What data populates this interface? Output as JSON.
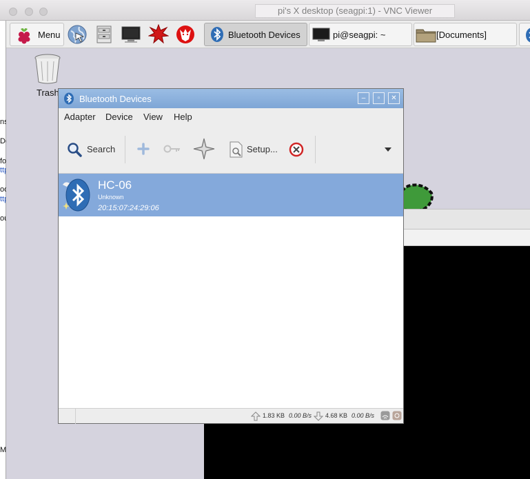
{
  "mac_window": {
    "title": "pi's X desktop (seagpi:1) - VNC Viewer"
  },
  "taskbar": {
    "menu_label": "Menu",
    "launchers": [
      "web-browser-icon",
      "file-manager-icon",
      "terminal-icon",
      "mathematica-icon",
      "wolfram-icon"
    ],
    "tasks": [
      {
        "label": "Bluetooth Devices",
        "icon": "bluetooth-icon",
        "active": true
      },
      {
        "label": "pi@seagpi: ~",
        "icon": "terminal-icon",
        "active": false
      },
      {
        "label": "[Documents]",
        "icon": "folder-icon",
        "active": false
      }
    ]
  },
  "desktop": {
    "trash_label": "Trash"
  },
  "left_fragments": [
    "ns",
    "Do",
    "fo",
    "ttp",
    "oo",
    "ttp",
    "ou",
    "M"
  ],
  "bt_window": {
    "title": "Bluetooth Devices",
    "menu": [
      "Adapter",
      "Device",
      "View",
      "Help"
    ],
    "toolbar": {
      "search_label": "Search",
      "setup_label": "Setup..."
    },
    "devices": [
      {
        "name": "HC-06",
        "type": "Unknown",
        "address": "20:15:07:24:29:06"
      }
    ],
    "status": {
      "upload_total": "1.83 KB",
      "upload_rate": "0.00 B/s",
      "download_total": "4.68 KB",
      "download_rate": "0.00 B/s"
    }
  },
  "colors": {
    "selection": "#84a9db",
    "titlebar": "#8aafdb",
    "desktop": "#d5d3de"
  }
}
